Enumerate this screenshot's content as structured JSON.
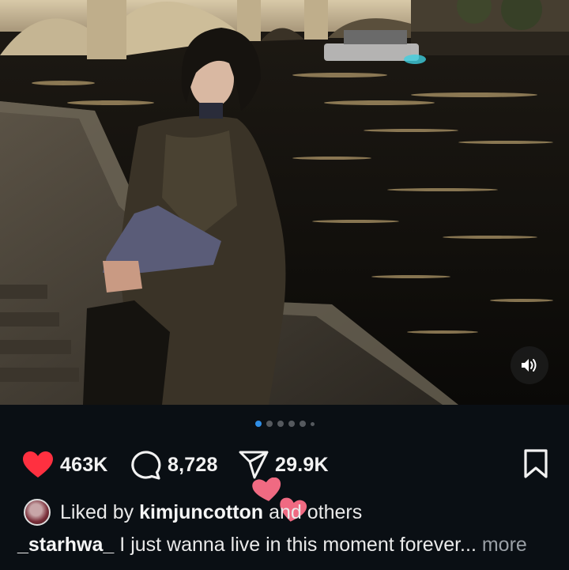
{
  "post": {
    "media_description_icon": "photo-carousel",
    "sound_icon": "speaker-icon",
    "carousel": {
      "count": 6,
      "active_index": 0
    },
    "likes": "463K",
    "comments": "8,728",
    "shares": "29.9K",
    "liked_by": {
      "prefix": "Liked by",
      "user": "kimjuncotton",
      "suffix": "and others"
    },
    "caption": {
      "user": "_starhwa_",
      "text": "I just wanna live in this moment forever...",
      "more": "more"
    }
  },
  "colors": {
    "like_red": "#ff3040",
    "active_dot": "#2f8ee6",
    "heart_pink": "#f06a82"
  }
}
